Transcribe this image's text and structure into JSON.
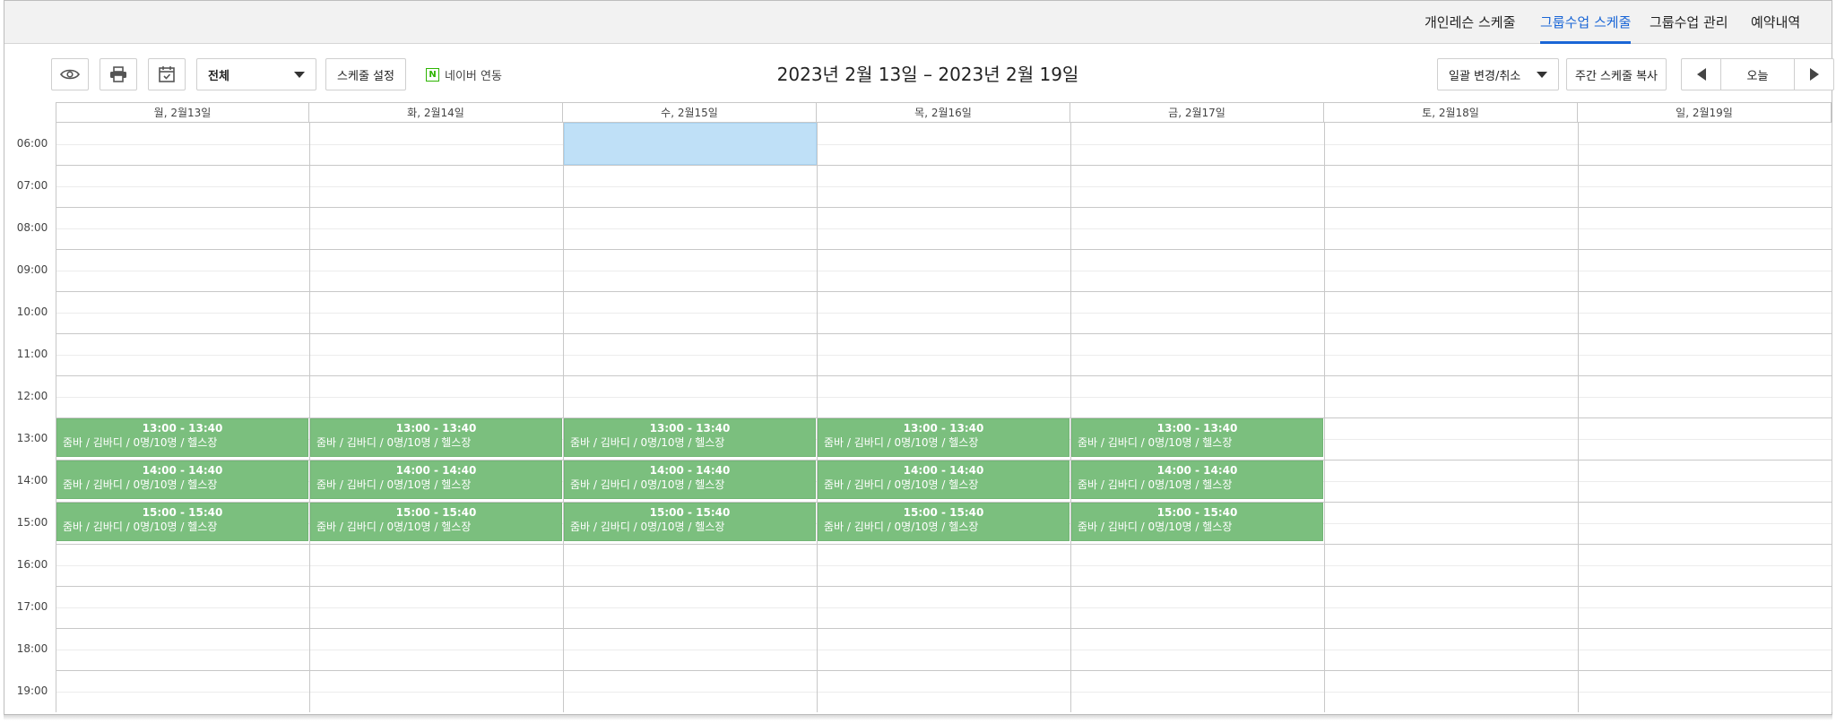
{
  "topnav": {
    "tabs": [
      {
        "label": "개인레슨 스케줄",
        "active": false
      },
      {
        "label": "그룹수업 스케줄",
        "active": true
      },
      {
        "label": "그룹수업 관리",
        "active": false
      },
      {
        "label": "예약내역",
        "active": false
      }
    ]
  },
  "toolbar": {
    "icons": [
      "eye-icon",
      "printer-icon",
      "calendar-check-icon"
    ],
    "filter_value": "전체",
    "schedule_settings_label": "스케줄 설정",
    "naver_badge": "N",
    "naver_label": "네이버 연동",
    "title": "2023년 2월 13일 – 2023년 2월 19일",
    "bulk_change_label": "일괄 변경/취소",
    "copy_week_label": "주간 스케줄 복사",
    "today_label": "오늘"
  },
  "calendar": {
    "days": [
      "월, 2월13일",
      "화, 2월14일",
      "수, 2월15일",
      "목, 2월16일",
      "금, 2월17일",
      "토, 2월18일",
      "일, 2월19일"
    ],
    "hours": [
      "06:00",
      "07:00",
      "08:00",
      "09:00",
      "10:00",
      "11:00",
      "12:00",
      "13:00",
      "14:00",
      "15:00",
      "16:00",
      "17:00",
      "18:00",
      "19:00"
    ],
    "selected": {
      "day_index": 2,
      "hour_index": 0
    },
    "event_color": "#7bbf7e",
    "selection_color": "#bfe0f7",
    "events": [
      {
        "day_index": 0,
        "hour_index": 7,
        "time": "13:00 - 13:40",
        "desc": "줌바 / 김바디 / 0명/10명 / 헬스장"
      },
      {
        "day_index": 1,
        "hour_index": 7,
        "time": "13:00 - 13:40",
        "desc": "줌바 / 김바디 / 0명/10명 / 헬스장"
      },
      {
        "day_index": 2,
        "hour_index": 7,
        "time": "13:00 - 13:40",
        "desc": "줌바 / 김바디 / 0명/10명 / 헬스장"
      },
      {
        "day_index": 3,
        "hour_index": 7,
        "time": "13:00 - 13:40",
        "desc": "줌바 / 김바디 / 0명/10명 / 헬스장"
      },
      {
        "day_index": 4,
        "hour_index": 7,
        "time": "13:00 - 13:40",
        "desc": "줌바 / 김바디 / 0명/10명 / 헬스장"
      },
      {
        "day_index": 0,
        "hour_index": 8,
        "time": "14:00 - 14:40",
        "desc": "줌바 / 김바디 / 0명/10명 / 헬스장"
      },
      {
        "day_index": 1,
        "hour_index": 8,
        "time": "14:00 - 14:40",
        "desc": "줌바 / 김바디 / 0명/10명 / 헬스장"
      },
      {
        "day_index": 2,
        "hour_index": 8,
        "time": "14:00 - 14:40",
        "desc": "줌바 / 김바디 / 0명/10명 / 헬스장"
      },
      {
        "day_index": 3,
        "hour_index": 8,
        "time": "14:00 - 14:40",
        "desc": "줌바 / 김바디 / 0명/10명 / 헬스장"
      },
      {
        "day_index": 4,
        "hour_index": 8,
        "time": "14:00 - 14:40",
        "desc": "줌바 / 김바디 / 0명/10명 / 헬스장"
      },
      {
        "day_index": 0,
        "hour_index": 9,
        "time": "15:00 - 15:40",
        "desc": "줌바 / 김바디 / 0명/10명 / 헬스장"
      },
      {
        "day_index": 1,
        "hour_index": 9,
        "time": "15:00 - 15:40",
        "desc": "줌바 / 김바디 / 0명/10명 / 헬스장"
      },
      {
        "day_index": 2,
        "hour_index": 9,
        "time": "15:00 - 15:40",
        "desc": "줌바 / 김바디 / 0명/10명 / 헬스장"
      },
      {
        "day_index": 3,
        "hour_index": 9,
        "time": "15:00 - 15:40",
        "desc": "줌바 / 김바디 / 0명/10명 / 헬스장"
      },
      {
        "day_index": 4,
        "hour_index": 9,
        "time": "15:00 - 15:40",
        "desc": "줌바 / 김바디 / 0명/10명 / 헬스장"
      }
    ]
  }
}
